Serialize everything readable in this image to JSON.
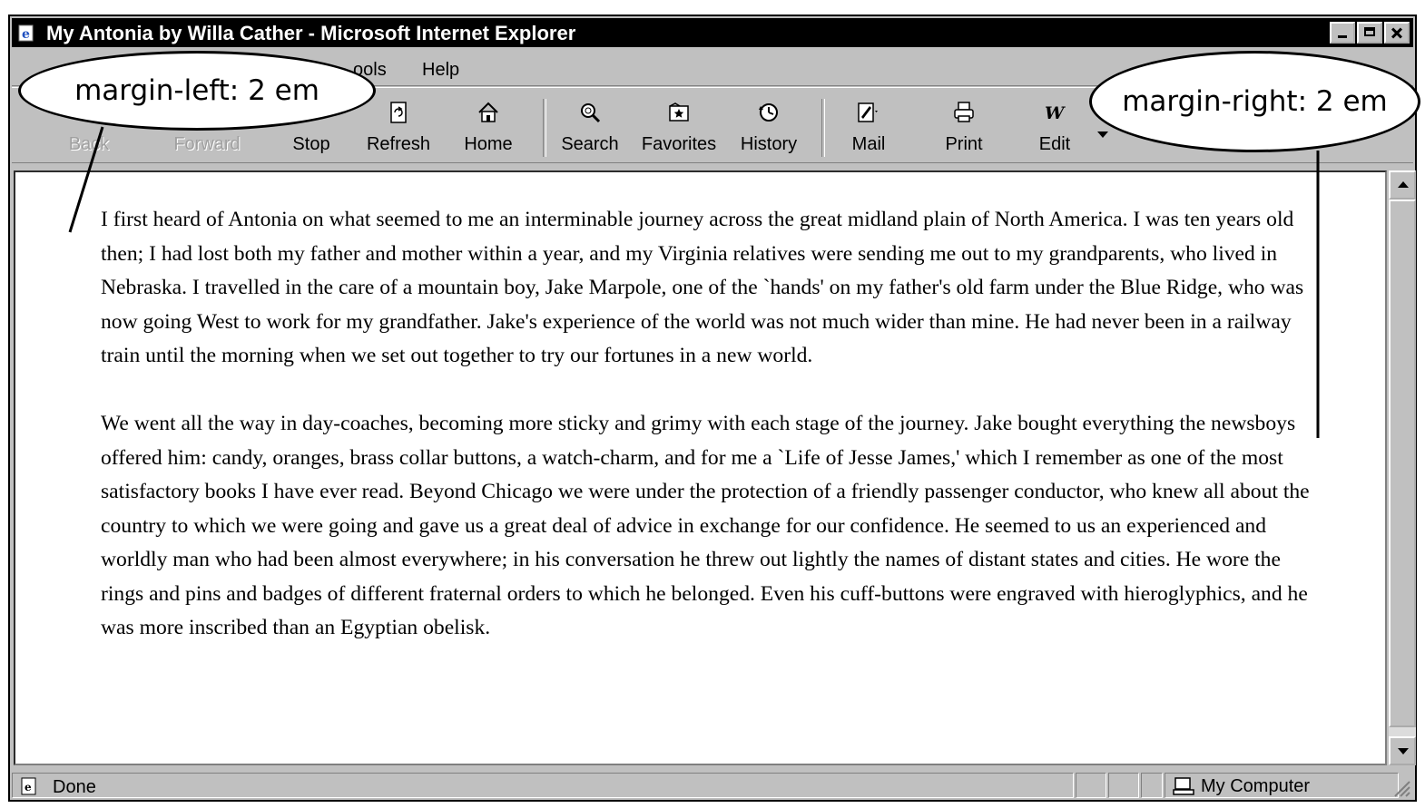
{
  "window": {
    "title": "My Antonia by Willa Cather - Microsoft Internet Explorer"
  },
  "menu": {
    "items": [
      "ools",
      "Help"
    ]
  },
  "toolbar": {
    "back": "Back",
    "forward": "Forward",
    "stop": "Stop",
    "refresh": "Refresh",
    "home": "Home",
    "search": "Search",
    "favorites": "Favorites",
    "history": "History",
    "mail": "Mail",
    "print": "Print",
    "edit": "Edit"
  },
  "content": {
    "paragraphs": [
      "I first heard of Antonia on what seemed to me an interminable journey across the great midland plain of North America. I was ten years old then; I had lost both my father and mother within a year, and my Virginia relatives were sending me out to my grandparents, who lived in Nebraska. I travelled in the care of a mountain boy, Jake Marpole, one of the `hands' on my father's old farm under the Blue Ridge, who was now going West to work for my grandfather. Jake's experience of the world was not much wider than mine. He had never been in a railway train until the morning when we set out together to try our fortunes in a new world.",
      "We went all the way in day-coaches, becoming more sticky and grimy with each stage of the journey. Jake bought everything the newsboys offered him: candy, oranges, brass collar buttons, a watch-charm, and for me a `Life of Jesse James,' which I remember as one of the most satisfactory books I have ever read. Beyond Chicago we were under the protection of a friendly passenger conductor, who knew all about the country to which we were going and gave us a great deal of advice in exchange for our confidence. He seemed to us an experienced and worldly man who had been almost everywhere; in his conversation he threw out lightly the names of distant states and cities. He wore the rings and pins and badges of different fraternal orders to which he belonged. Even his cuff-buttons were engraved with hieroglyphics, and he was more inscribed than an Egyptian obelisk."
    ]
  },
  "status": {
    "text": "Done",
    "zone": "My Computer"
  },
  "annotations": {
    "left": "margin-left: 2 em",
    "right": "margin-right: 2 em"
  }
}
